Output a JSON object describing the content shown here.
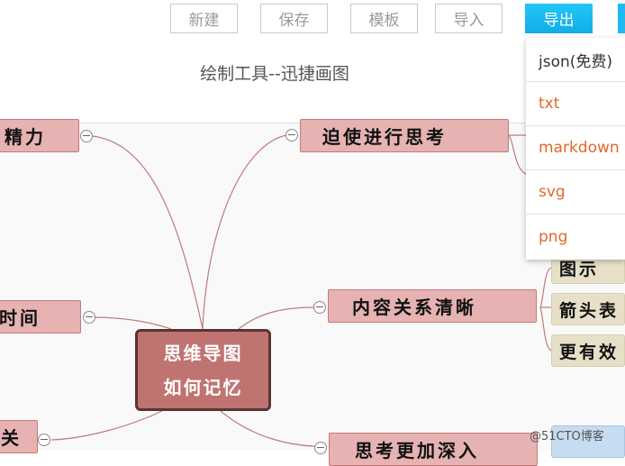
{
  "toolbar": {
    "new_label": "新建",
    "save_label": "保存",
    "template_label": "模板",
    "import_label": "导入",
    "export_label": "导出"
  },
  "app_title": "绘制工具--迅捷画图",
  "export_menu": {
    "items": [
      "json(免费)",
      "txt",
      "markdown",
      "svg",
      "png"
    ]
  },
  "mindmap": {
    "root_line1": "思维导图",
    "root_line2": "如何记忆",
    "nodes": {
      "energy": "精力",
      "force_thinking": "迫使进行思考",
      "time": "时间",
      "clear_relations": "内容关系清晰",
      "bottom_left": "关",
      "bottom_right": "思考更加深入"
    },
    "leaves": {
      "diagram": "图示",
      "arrow": "箭头表",
      "more_effective": "更有效"
    }
  },
  "watermark": "@51CTO博客",
  "colors": {
    "accent": "#11aee8",
    "node_fill": "#e6b2b2",
    "root_fill": "#c07472",
    "menu_item": "#e0682c"
  }
}
